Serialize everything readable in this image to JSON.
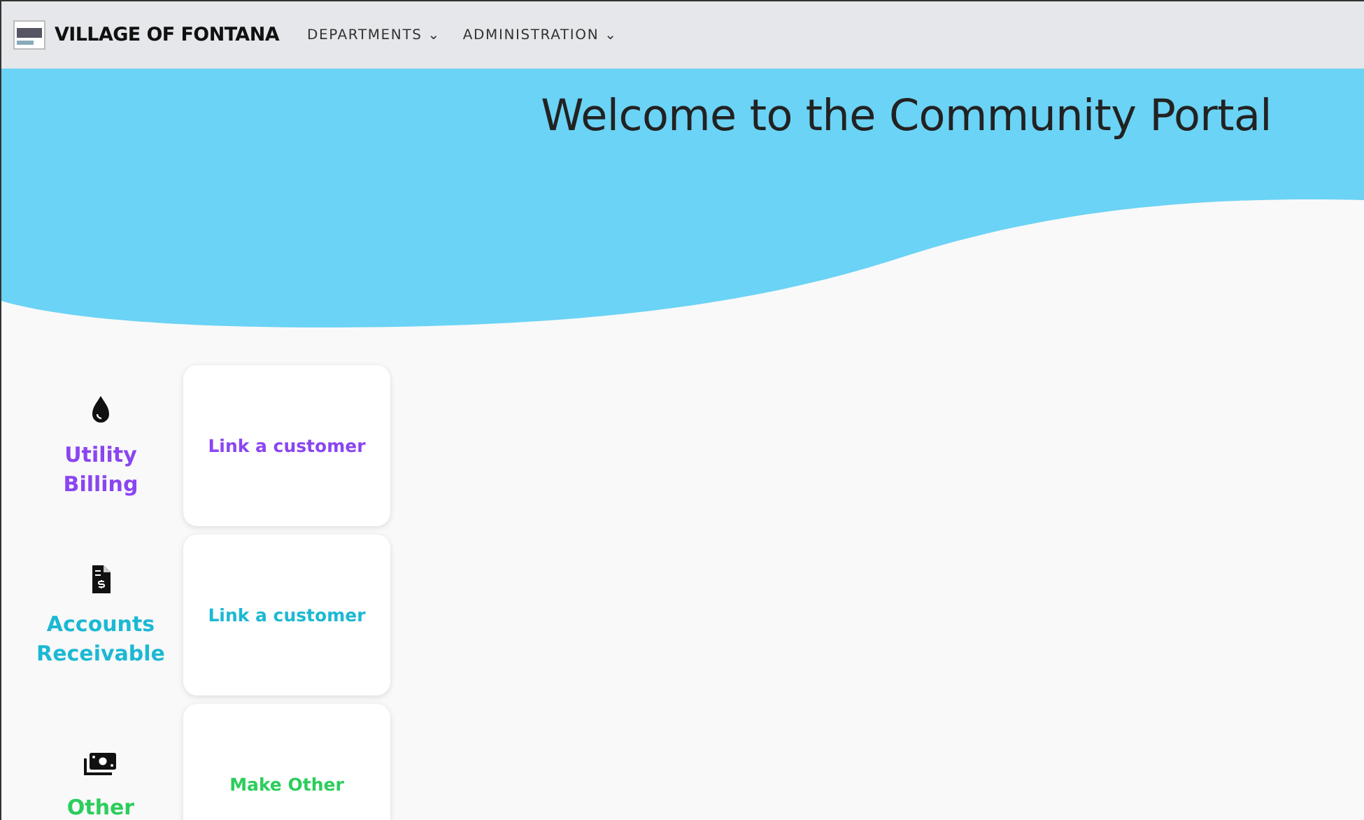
{
  "header": {
    "brand": "VILLAGE OF FONTANA",
    "menu": [
      {
        "label": "DEPARTMENTS",
        "caret": "⌄"
      },
      {
        "label": "ADMINISTRATION",
        "caret": "⌄"
      }
    ]
  },
  "hero": {
    "title": "Welcome to the Community Portal"
  },
  "departments": [
    {
      "kind": "water",
      "name": "Utility Billing",
      "color": "#8b45f0",
      "action": "Link a customer"
    },
    {
      "kind": "invoice",
      "name": "Accounts Receivable",
      "color": "#1cb8d4",
      "action": "Link a customer"
    },
    {
      "kind": "money",
      "name": "Other",
      "color": "#2ccd5c",
      "action": "Make Other"
    }
  ]
}
